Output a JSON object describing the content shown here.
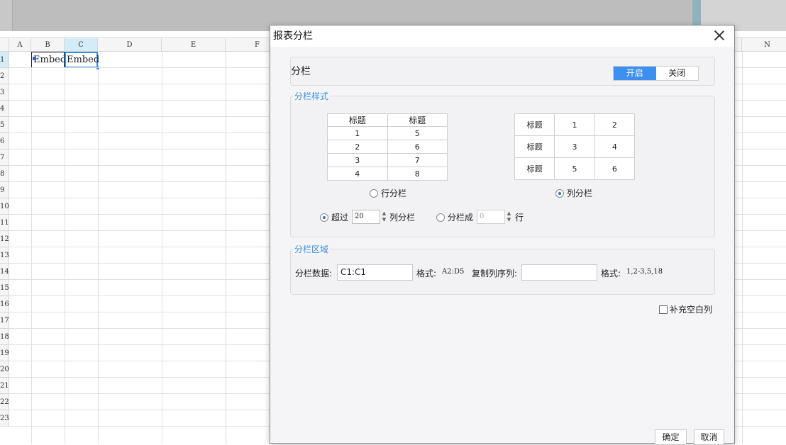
{
  "spreadsheet": {
    "columns": [
      "",
      "A",
      "B",
      "C",
      "D",
      "E",
      "F",
      "",
      "N"
    ],
    "rows": [
      "1",
      "2",
      "3",
      "4",
      "5",
      "6",
      "7",
      "8",
      "9",
      "10",
      "11",
      "12",
      "13",
      "14",
      "15",
      "16",
      "17",
      "18",
      "19",
      "20",
      "21",
      "22",
      "23"
    ],
    "cells": {
      "B1": "Embed",
      "C1": "Embed"
    }
  },
  "dialog": {
    "title": "报表分栏",
    "toggle": {
      "label": "分栏",
      "on_label": "开启",
      "off_label": "关闭",
      "state": "on"
    },
    "style_section": {
      "title": "分栏样式",
      "row_table": [
        [
          "标题",
          "标题"
        ],
        [
          "1",
          "5"
        ],
        [
          "2",
          "6"
        ],
        [
          "3",
          "7"
        ],
        [
          "4",
          "8"
        ]
      ],
      "col_table": [
        [
          "标题",
          "1",
          "2"
        ],
        [
          "标题",
          "3",
          "4"
        ],
        [
          "标题",
          "5",
          "6"
        ]
      ],
      "row_option": "行分栏",
      "col_option": "列分栏",
      "selected": "col",
      "exceed_label": "超过",
      "exceed_value": "20",
      "exceed_suffix": "列分栏",
      "split_label": "分栏成",
      "split_value": "0",
      "split_suffix": "行",
      "exceed_selected": true
    },
    "area_section": {
      "title": "分栏区域",
      "data_label": "分栏数据:",
      "data_value": "C1:C1",
      "format_label": "格式:",
      "format_example": "A2:D5",
      "copy_label": "复制列序列:",
      "copy_value": "",
      "copy_format_example": "1,2-3,5,18"
    },
    "fill_blank_label": "补充空白列",
    "ok_label": "确定",
    "cancel_label": "取消"
  }
}
